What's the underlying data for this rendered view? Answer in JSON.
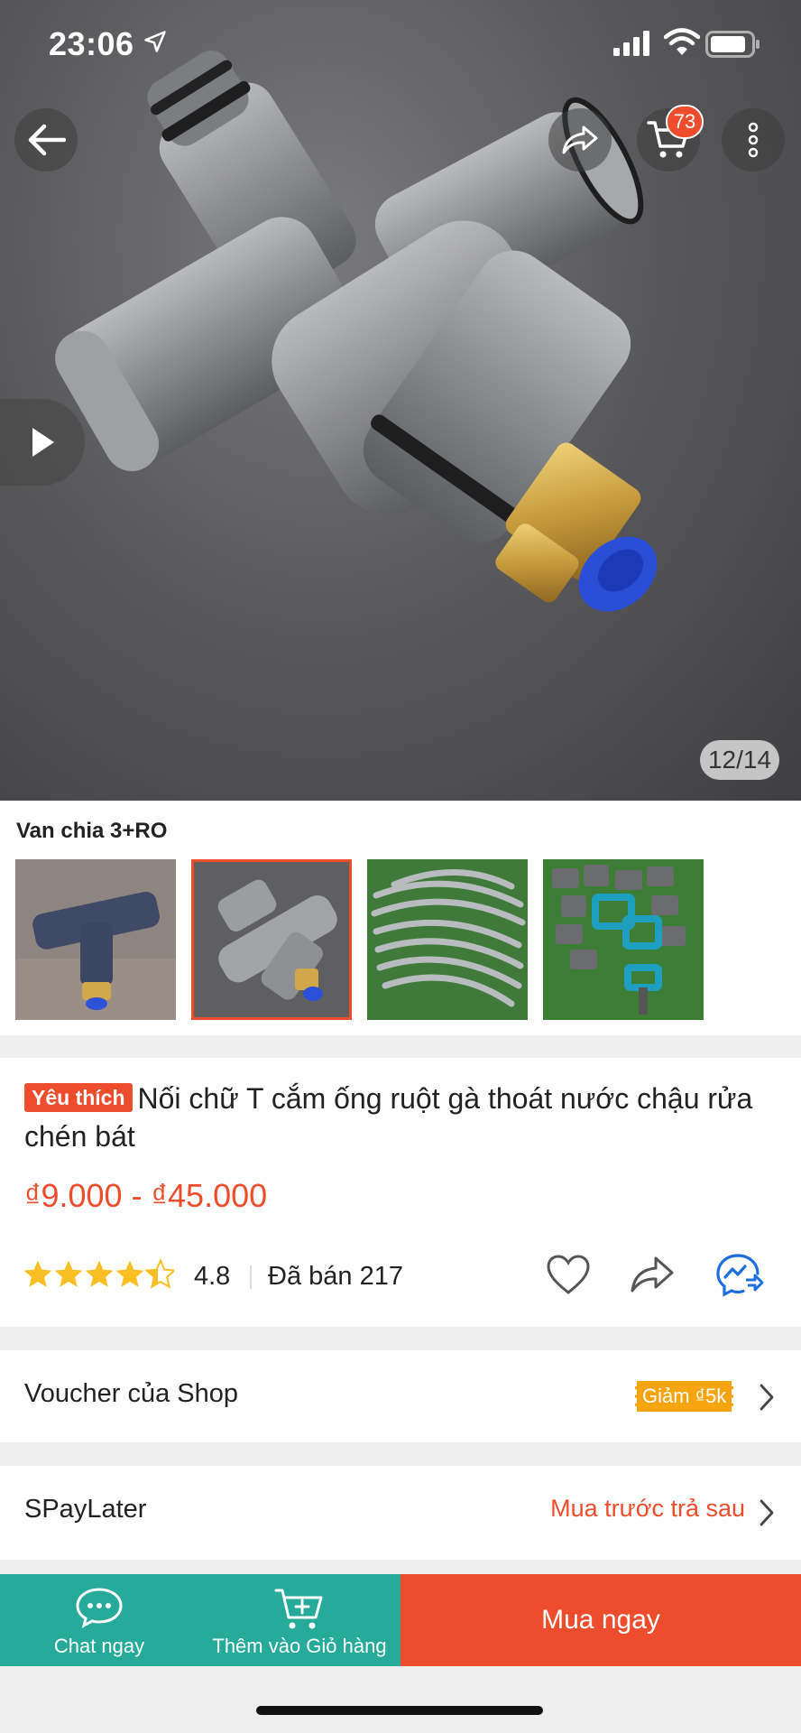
{
  "status_bar": {
    "time": "23:06"
  },
  "header": {
    "cart_count": "73"
  },
  "gallery": {
    "counter": "12/14"
  },
  "variant": {
    "label": "Van chia 3+RO"
  },
  "product": {
    "badge": "Yêu thích",
    "title": "Nối chữ T cắm ống ruột gà thoát nước chậu rửa chén bát",
    "price": "₫9.000 - ₫45.000",
    "rating": "4.8",
    "rating_stars": 4.8,
    "sold": "Đã bán 217"
  },
  "voucher_row": {
    "label": "Voucher của Shop",
    "tag": "Giảm ₫5k"
  },
  "spay_row": {
    "label": "SPayLater",
    "value": "Mua trước trả sau"
  },
  "bottom_bar": {
    "chat_label": "Chat ngay",
    "cart_label": "Thêm vào Giỏ hàng",
    "buy_label": "Mua ngay"
  },
  "colors": {
    "accent": "#ee4d2d",
    "teal": "#26aa99",
    "voucher": "#f6a50e",
    "star": "#fbbf24"
  }
}
